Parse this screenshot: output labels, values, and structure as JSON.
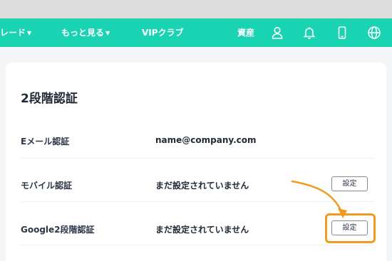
{
  "nav": {
    "items": [
      {
        "label": "レード",
        "caret": "▼"
      },
      {
        "label": "もっと見る",
        "caret": "▼"
      },
      {
        "label": "VIPクラブ",
        "caret": ""
      }
    ],
    "assets_label": "資産",
    "icons": [
      "user-icon",
      "bell-icon",
      "mobile-icon",
      "globe-icon"
    ]
  },
  "section": {
    "title": "2段階認証",
    "rows": [
      {
        "label": "Eメール認証",
        "value": "name@company.com",
        "button": null
      },
      {
        "label": "モバイル認証",
        "value": "まだ設定されていません",
        "button": "設定"
      },
      {
        "label": "Google2段階認証",
        "value": "まだ設定されていません",
        "button": "設定"
      }
    ]
  },
  "colors": {
    "nav_bg": "#1ad3b3",
    "highlight": "#f29a1d"
  }
}
